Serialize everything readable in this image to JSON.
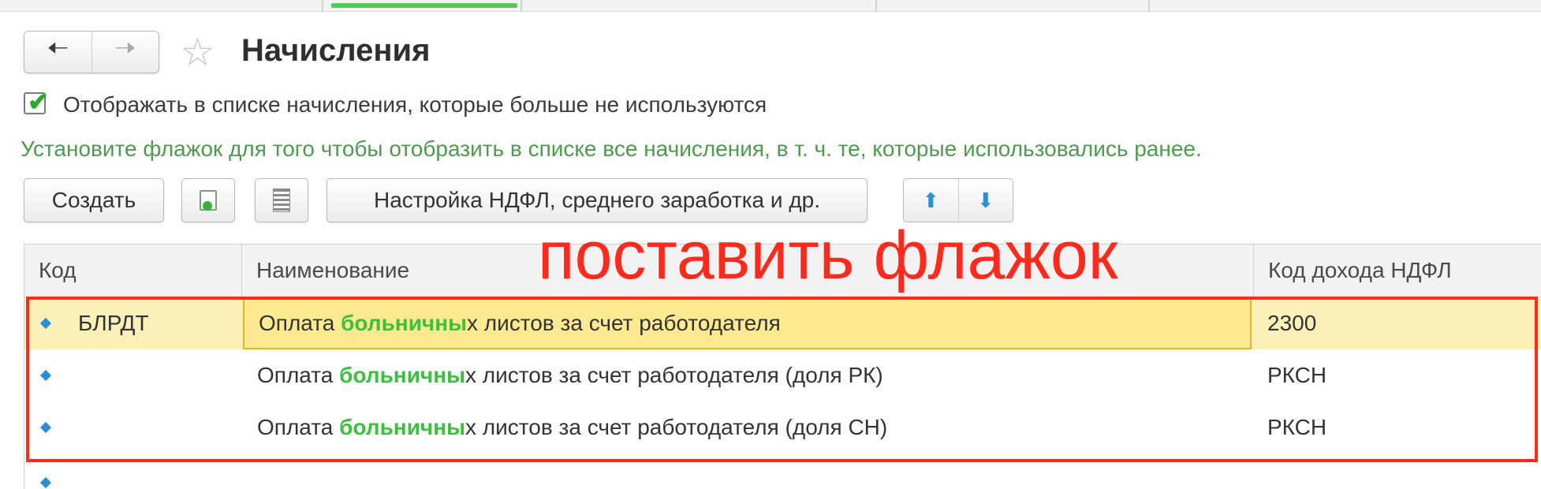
{
  "window": {
    "title": "Начисления"
  },
  "nav": {
    "back_icon": "arrow-left-icon",
    "forward_icon": "arrow-right-icon",
    "favorite_icon": "star-icon"
  },
  "options": {
    "show_unused_label": "Отображать в списке начисления, которые больше не используются",
    "show_unused_checked": true,
    "hint": "Установите флажок для того чтобы отобразить в списке все начисления, в т. ч. те, которые использовались ранее."
  },
  "toolbar": {
    "create_label": "Создать",
    "copy_icon": "copy-document-icon",
    "list_icon": "list-icon",
    "ndfl_settings_label": "Настройка НДФЛ, среднего заработка и др.",
    "move_up_icon": "arrow-up-icon",
    "move_down_icon": "arrow-down-icon"
  },
  "table": {
    "columns": [
      "Код",
      "Наименование",
      "Код дохода НДФЛ"
    ],
    "rows": [
      {
        "code": "БЛРДТ",
        "name_prefix": "Оплата ",
        "name_highlight": "больничны",
        "name_suffix": "х листов за счет работодателя",
        "ndfl_code": "2300",
        "selected": true
      },
      {
        "code": "",
        "name_prefix": "Оплата ",
        "name_highlight": "больничны",
        "name_suffix": "х листов за счет работодателя (доля РК)",
        "ndfl_code": "РКСН",
        "selected": false
      },
      {
        "code": "",
        "name_prefix": "Оплата ",
        "name_highlight": "больничны",
        "name_suffix": "х листов за счет работодателя (доля СН)",
        "ndfl_code": "РКСН",
        "selected": false
      }
    ],
    "highlight_color": "#3fbf3f",
    "selected_row_color": "#fbf0b8"
  },
  "annotation": {
    "text": "поставить флажок",
    "color": "#ff2a1c"
  }
}
